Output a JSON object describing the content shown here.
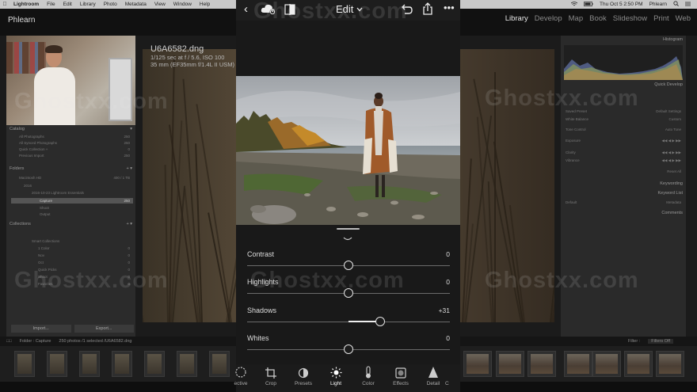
{
  "menubar": {
    "app_name": "Lightroom",
    "items": [
      "File",
      "Edit",
      "Library",
      "Photo",
      "Metadata",
      "View",
      "Window",
      "Help"
    ],
    "clock": "Thu Oct 5 2:50 PM",
    "user": "Phlearn"
  },
  "lightroom_classic": {
    "brand": "Phlearn",
    "modules": [
      "Library",
      "Develop",
      "Map",
      "Book",
      "Slideshow",
      "Print",
      "Web"
    ],
    "active_module": "Library",
    "left_panel": {
      "catalog_title": "Catalog",
      "catalog_items": [
        {
          "label": "All Photographs",
          "count": "250"
        },
        {
          "label": "All Synced Photographs",
          "count": "250"
        },
        {
          "label": "Quick Collection +",
          "count": "0"
        },
        {
          "label": "Previous Import",
          "count": "250"
        }
      ],
      "folders_title": "Folders",
      "folders": [
        {
          "label": "Macintosh HD",
          "count": "400 / 1 TB"
        },
        {
          "label": "2016",
          "count": ""
        },
        {
          "label": "2016-10-23 Lightroom Essentials",
          "count": ""
        },
        {
          "label": "Capture",
          "count": "250"
        },
        {
          "label": "Shoot",
          "count": ""
        },
        {
          "label": "Output",
          "count": ""
        }
      ],
      "collections_title": "Collections",
      "collections": [
        {
          "label": "Smart Collections",
          "count": ""
        },
        {
          "label": "1 Color",
          "count": "0"
        },
        {
          "label": "Nov",
          "count": "0"
        },
        {
          "label": "Oct",
          "count": "0"
        },
        {
          "label": "Quick Picks",
          "count": "0"
        },
        {
          "label": "Shoot",
          "count": "0"
        },
        {
          "label": "Favorites",
          "count": "0"
        }
      ],
      "import_label": "Import...",
      "export_label": "Export..."
    },
    "photo_meta": {
      "filename": "U6A6582.dng",
      "line1": "1/125 sec at f / 5.6, ISO 100",
      "line2": "35 mm (EF35mm f/1.4L II USM)"
    },
    "right_panel": {
      "histogram_title": "Histogram",
      "quick_develop_title": "Quick Develop",
      "saved_preset_label": "Saved Preset",
      "saved_preset_value": "Default Settings",
      "white_balance_label": "White Balance",
      "white_balance_value": "Custom",
      "tone_control_label": "Tone Control",
      "tone_control_value": "Auto Tone",
      "exposure_label": "Exposure",
      "clarity_label": "Clarity",
      "vibrance_label": "Vibrance",
      "reset_label": "Reset All",
      "keywording_title": "Keywording",
      "keyword_list_title": "Keyword List",
      "metadata_title": "Metadata",
      "metadata_preset": "Default",
      "comments_title": "Comments"
    },
    "filmstrip_bar": {
      "source": "Folder : Capture",
      "count": "250 photos /1 selected /U6A6582.dng",
      "filter_label": "Filter :",
      "filter_value": "Filters Off"
    }
  },
  "mobile": {
    "edit_label": "Edit",
    "photo_alt": "Woman in coat on rocky lakeshore",
    "sliders": [
      {
        "label": "Contrast",
        "value": "0",
        "position": 0.5
      },
      {
        "label": "Highlights",
        "value": "0",
        "position": 0.5
      },
      {
        "label": "Shadows",
        "value": "+31",
        "position": 0.655
      },
      {
        "label": "Whites",
        "value": "0",
        "position": 0.5
      }
    ],
    "tools": [
      {
        "label": "ective",
        "icon": "selective-icon",
        "active": false
      },
      {
        "label": "Crop",
        "icon": "crop-icon",
        "active": false
      },
      {
        "label": "Presets",
        "icon": "presets-icon",
        "active": false
      },
      {
        "label": "Light",
        "icon": "light-icon",
        "active": true
      },
      {
        "label": "Color",
        "icon": "color-icon",
        "active": false
      },
      {
        "label": "Effects",
        "icon": "effects-icon",
        "active": false
      },
      {
        "label": "Detail",
        "icon": "detail-icon",
        "active": false
      }
    ]
  },
  "watermark": "Ghostxx.com",
  "colors": {
    "background": "#1b1b1b",
    "panel": "#2b2b2b",
    "mobile_bg": "#191919",
    "slider_knob_border": "#e4e4e4"
  }
}
